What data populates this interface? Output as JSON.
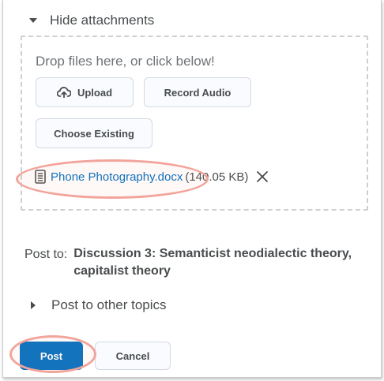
{
  "attachments": {
    "toggle_label": "Hide attachments",
    "drop_text": "Drop files here, or click below!",
    "upload_label": "Upload",
    "record_audio_label": "Record Audio",
    "choose_existing_label": "Choose Existing",
    "file": {
      "name": "Phone Photography.docx",
      "size": "(140.05 KB)"
    }
  },
  "post_to": {
    "label": "Post to:",
    "value": "Discussion 3: Semanticist neodialectic theory, capitalist theory"
  },
  "other_topics_label": "Post to other topics",
  "actions": {
    "post_label": "Post",
    "cancel_label": "Cancel"
  },
  "colors": {
    "primary": "#006fbf",
    "link": "#006fbf",
    "highlight": "#f2a39a"
  }
}
